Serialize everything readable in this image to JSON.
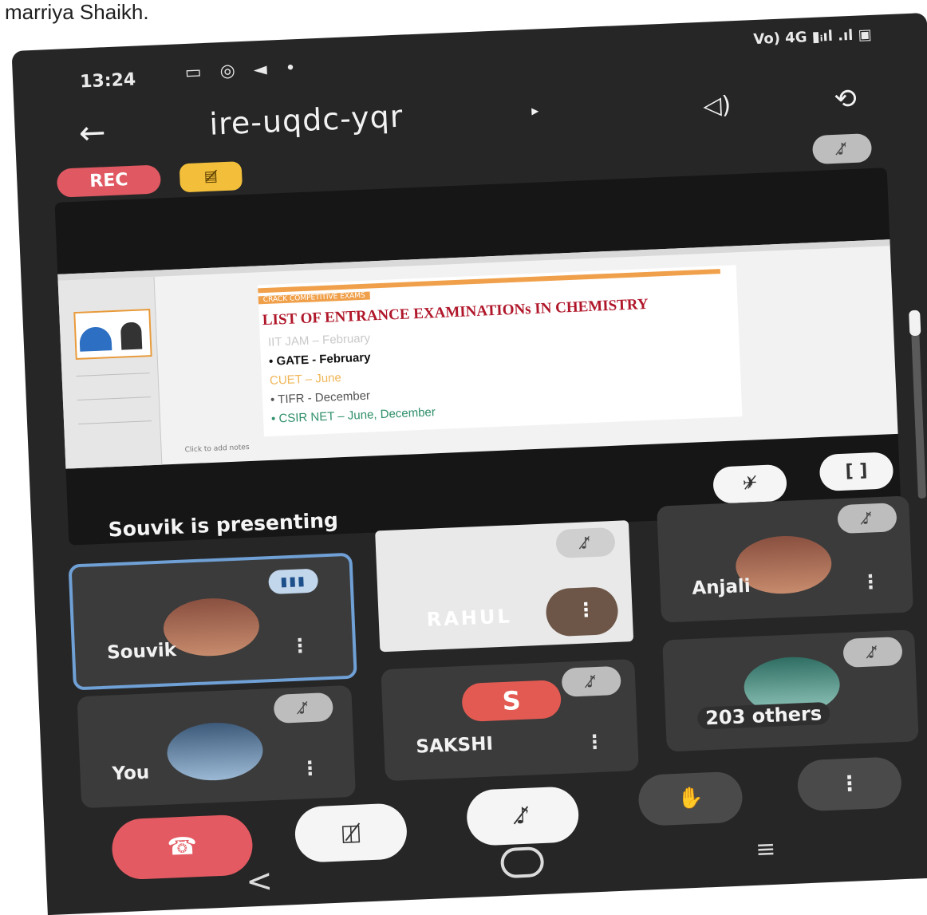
{
  "caption": "marriya Shaikh.",
  "status_bar": {
    "time": "13:24",
    "app_icons": "▭ ◎ ◄ •",
    "right_indicators": "Vo) 4G ▮ᵢıl .ıl ▣"
  },
  "topbar": {
    "back_icon": "←",
    "meeting_code": "ire-uqdc-yqr",
    "caret_icon": "▸",
    "speaker_icon": "◁)",
    "camera_switch_icon": "⟲"
  },
  "badges": {
    "rec_label": "REC",
    "captions_icon": "▤̸"
  },
  "icons": {
    "mic_off": "♪̸",
    "unpin": "✈̸",
    "fullscreen": "[ ]",
    "speaking": "▮▮▮",
    "more": "⋮",
    "end_call": "☎",
    "camera_off": "◫̸",
    "raise_hand": "✋"
  },
  "slide": {
    "label": "CRACK COMPETITIVE EXAMS",
    "title": "LIST OF ENTRANCE EXAMINATIONs IN CHEMISTRY",
    "bullets": [
      {
        "text": "IIT JAM – February",
        "color": "#c9c9c9"
      },
      {
        "text": "• GATE - February",
        "color": "#111111"
      },
      {
        "text": "CUET – June",
        "color": "#f0b657"
      },
      {
        "text": "• TIFR - December",
        "color": "#555555"
      },
      {
        "text": "• CSIR NET – June, December",
        "color": "#2f8f6a"
      }
    ],
    "notes": "Click to add notes"
  },
  "presenting_text": "Souvik is presenting",
  "participants": {
    "souvik": "Souvik",
    "rahul_overlay": "RAHUL",
    "anjali": "Anjali",
    "you": "You",
    "sakshi": "SAKSHI",
    "sakshi_initial": "S",
    "others": "203 others"
  },
  "nav": {
    "back": "<",
    "recents": "≡"
  },
  "colors": {
    "rec": "#e05862",
    "captions": "#f3bf3a",
    "end_call": "#e35a62",
    "active_border": "#6fa0d6"
  }
}
